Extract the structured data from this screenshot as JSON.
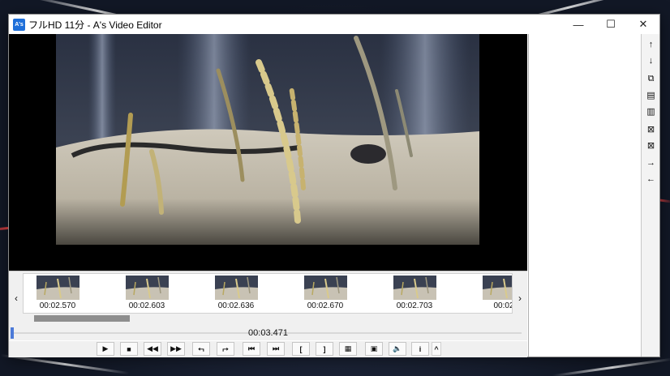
{
  "window": {
    "icon_text": "A's",
    "title": "フルHD 11分 - A's Video Editor",
    "minimize": "—",
    "maximize": "☐",
    "close": "✕"
  },
  "timeline": {
    "thumbnails": [
      {
        "time": "00:02.570"
      },
      {
        "time": "00:02.603"
      },
      {
        "time": "00:02.636"
      },
      {
        "time": "00:02.670"
      },
      {
        "time": "00:02.703"
      },
      {
        "time": "00:02"
      }
    ],
    "scroll_left_glyph": "‹",
    "scroll_right_glyph": "›"
  },
  "playback": {
    "current_time": "00:03.471"
  },
  "controls": [
    {
      "name": "play-button",
      "icon": "▶"
    },
    {
      "name": "stop-button",
      "icon": "■"
    },
    {
      "name": "rewind-button",
      "icon": "◀◀"
    },
    {
      "name": "fast-forward-button",
      "icon": "▶▶"
    },
    {
      "name": "jump-start-button",
      "icon": "⮢"
    },
    {
      "name": "jump-end-button",
      "icon": "⮣"
    },
    {
      "name": "prev-frame-button",
      "icon": "⏮"
    },
    {
      "name": "next-frame-button",
      "icon": "⏭"
    },
    {
      "name": "mark-in-button",
      "icon": "["
    },
    {
      "name": "mark-out-button",
      "icon": "]"
    },
    {
      "name": "filmstrip-button",
      "icon": "▦"
    },
    {
      "name": "crop-button",
      "icon": "▣"
    },
    {
      "name": "volume-button",
      "icon": "🔈"
    },
    {
      "name": "info-button",
      "icon": "i"
    },
    {
      "name": "expand-button",
      "icon": "^"
    }
  ],
  "side_toolbar": [
    {
      "name": "move-up-icon",
      "icon": "↑"
    },
    {
      "name": "move-down-icon",
      "icon": "↓"
    },
    {
      "name": "insert-clip-icon",
      "icon": "⧉"
    },
    {
      "name": "split-clip-icon",
      "icon": "▤"
    },
    {
      "name": "merge-clip-icon",
      "icon": "▥"
    },
    {
      "name": "delete-clip-icon",
      "icon": "⊠"
    },
    {
      "name": "delete-all-icon",
      "icon": "⊠"
    },
    {
      "name": "arrow-right-icon",
      "icon": "→"
    },
    {
      "name": "arrow-left-icon",
      "icon": "←"
    }
  ],
  "colors": {
    "accent": "#1e6fd9",
    "seek_handle": "#4c7ad8"
  }
}
